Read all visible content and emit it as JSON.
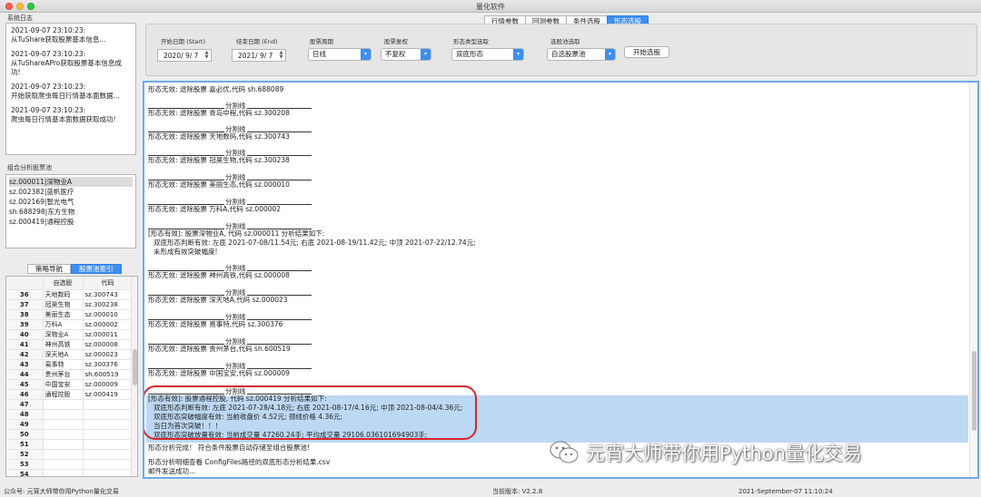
{
  "window": {
    "title": "量化软件"
  },
  "top_tabs": [
    "行情参数",
    "回测参数",
    "条件选股",
    "形态选股"
  ],
  "top_tab_active": 3,
  "left": {
    "log_label": "系统日志",
    "log_entries": [
      {
        "time": "2021-09-07 23:10:23:",
        "msg": "从TuShare获取股票基本信息..."
      },
      {
        "time": "2021-09-07 23:10:23:",
        "msg": "从TuShareAPro获取股票基本信息成功!"
      },
      {
        "time": "2021-09-07 23:10:23:",
        "msg": "开始获取爬虫每日行情基本面数据..."
      },
      {
        "time": "2021-09-07 23:10:23:",
        "msg": "爬虫每日行情基本面数据获取成功!"
      }
    ],
    "combo_label": "组合分析股票池",
    "combo_items": [
      "sz.000011|深物业A",
      "sz.002382|蓝帆医疗",
      "sz.002169|智光电气",
      "sh.688298|东方生物",
      "sz.000419|通程控股"
    ],
    "tabs": [
      "策略导航",
      "股票池索引"
    ],
    "tab_active": 1,
    "table_headers": [
      "",
      "自选股",
      "代码"
    ],
    "table_rows": [
      [
        "36",
        "天地数码",
        "sz.300743"
      ],
      [
        "37",
        "冠昊生物",
        "sz.300238"
      ],
      [
        "38",
        "美丽生态",
        "sz.000010"
      ],
      [
        "39",
        "万科A",
        "sz.000002"
      ],
      [
        "40",
        "深物业A",
        "sz.000011"
      ],
      [
        "41",
        "神州高铁",
        "sz.000008"
      ],
      [
        "42",
        "深天地A",
        "sz.000023"
      ],
      [
        "43",
        "易事特",
        "sz.300376"
      ],
      [
        "44",
        "贵州茅台",
        "sh.600519"
      ],
      [
        "45",
        "中国宝安",
        "sz.000009"
      ],
      [
        "46",
        "通程控股",
        "sz.000419"
      ],
      [
        "47",
        "",
        ""
      ],
      [
        "48",
        "",
        ""
      ],
      [
        "49",
        "",
        ""
      ],
      [
        "50",
        "",
        ""
      ],
      [
        "51",
        "",
        ""
      ],
      [
        "52",
        "",
        ""
      ],
      [
        "53",
        "",
        ""
      ],
      [
        "54",
        "",
        ""
      ]
    ]
  },
  "params": {
    "start_label": "开始日期 (Start)",
    "start_value": "2020/ 9/ 7",
    "end_label": "结束日期 (End)",
    "end_value": "2021/ 9/ 7",
    "period_label": "股票周期",
    "period_value": "日线",
    "adj_label": "股票复权",
    "adj_value": "不复权",
    "pattern_label": "形态类型选取",
    "pattern_value": "双底形态",
    "pool_label": "选股池选取",
    "pool_value": "自选股票池",
    "start_button": "开始选股"
  },
  "output": {
    "sep_label": "分割线",
    "lines": [
      "形态无效: 滤除股票 嘉必优,代码 sh.688089",
      "形态无效: 滤除股票 青岛中程,代码 sz.300208",
      "形态无效: 滤除股票 天地数码,代码 sz.300743",
      "形态无效: 滤除股票 冠昊生物,代码 sz.300238",
      "形态无效: 滤除股票 美丽生态,代码 sz.000010",
      "形态无效: 滤除股票 万科A,代码 sz.000002",
      "[形态有效]: 股票深物业A, 代码 sz.000011 分析结果如下:",
      "双底形态判断有效: 左底 2021-07-08/11.54元; 右底 2021-08-19/11.42元; 中顶 2021-07-22/12.74元;",
      "未形成有效突破幅度!",
      "形态无效: 滤除股票 神州高铁,代码 sz.000008",
      "形态无效: 滤除股票 深天地A,代码 sz.000023",
      "形态无效: 滤除股票 易事特,代码 sz.300376",
      "形态无效: 滤除股票 贵州茅台,代码 sh.600519",
      "形态无效: 滤除股票 中国宝安,代码 sz.000009",
      "[形态有效]: 股票通程控股, 代码 sz.000419 分析结果如下:",
      "双底形态判断有效: 左底 2021-07-28/4.18元; 右底 2021-08-17/4.16元; 中顶 2021-08-04/4.36元;",
      "双底形态突破幅度有效: 当前收盘价 4.52元; 颈线价格 4.36元;",
      "当日为首次突破！！！",
      "双底形态突破放量有效: 当前成交量 47260.24手; 平均成交量 29106.036101694903手;",
      "形态分析完成！ 符合条件股票自动存储至组合股票池!",
      "形态分析明细查看 ConfigFiles路径的双底形态分析结果.csv",
      "邮件发送成功..."
    ]
  },
  "watermark": {
    "text": "元宵大师带你用Python量化交易"
  },
  "status": {
    "left": "公众号: 元宵大师带你用Python量化交易",
    "version": "当前版本: V2.2.8",
    "datetime": "2021-September-07 11:10:24"
  },
  "colors": {
    "accent": "#3d8ff0",
    "highlight": "#bcd8f3",
    "annotation": "#d7272a"
  }
}
